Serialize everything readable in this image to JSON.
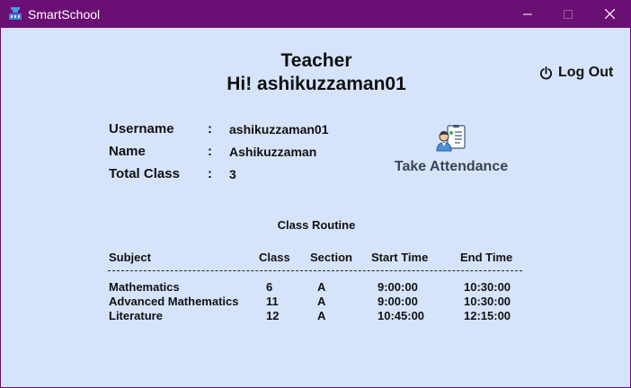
{
  "window": {
    "title": "SmartSchool",
    "controls": {
      "minimize_icon": "minimize-icon",
      "maximize_icon": "maximize-icon",
      "close_icon": "close-icon"
    },
    "colors": {
      "titlebar": "#6a0f73",
      "content_background": "#d6e4fb"
    }
  },
  "header": {
    "role": "Teacher",
    "greeting": "Hi! ashikuzzaman01"
  },
  "logout": {
    "icon": "power-icon",
    "label": "Log Out"
  },
  "profile": {
    "rows": [
      {
        "label": "Username",
        "separator": ":",
        "value": "ashikuzzaman01"
      },
      {
        "label": "Name",
        "separator": ":",
        "value": "Ashikuzzaman"
      },
      {
        "label": "Total Class",
        "separator": ":",
        "value": "3"
      }
    ]
  },
  "attendance": {
    "icon": "attendance-icon",
    "label": "Take Attendance"
  },
  "routine": {
    "title": "Class Routine",
    "columns": [
      "Subject",
      "Class",
      "Section",
      "Start Time",
      "End Time"
    ],
    "rows": [
      [
        "Mathematics",
        "6",
        "A",
        "9:00:00",
        "10:30:00"
      ],
      [
        "Advanced Mathematics",
        "11",
        "A",
        "9:00:00",
        "10:30:00"
      ],
      [
        "Literature",
        "12",
        "A",
        "10:45:00",
        "12:15:00"
      ]
    ]
  }
}
